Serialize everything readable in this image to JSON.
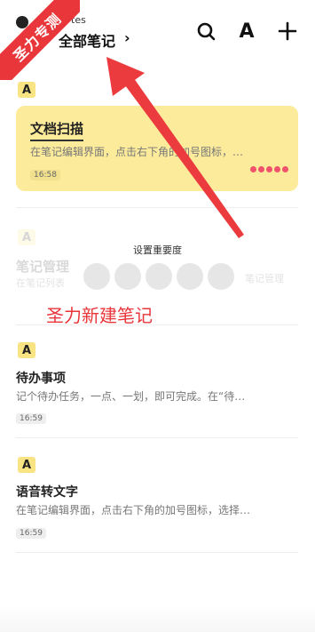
{
  "app": {
    "subtitle": "tes"
  },
  "header": {
    "folder_title": "全部笔记",
    "folder_chevron": "›",
    "search_icon": "search-icon",
    "font_icon": "A",
    "add_icon": "+"
  },
  "ribbon": {
    "text": "圣力专测"
  },
  "notes": [
    {
      "badge": "A",
      "title": "文档扫描",
      "summary": "在笔记编辑界面，点击右下角的加号图标，…",
      "time": "16:58",
      "highlighted": true,
      "importance_dots": 5
    },
    {
      "badge": "A",
      "title": "笔记管理",
      "summary": "在笔记列表",
      "time": "",
      "faded": true,
      "right_text": "笔记管理"
    },
    {
      "badge": "A",
      "title": "待办事项",
      "summary": "记个待办任务，一点、一划，即可完成。在“待…",
      "time": "16:59"
    },
    {
      "badge": "A",
      "title": "语音转文字",
      "summary": "在笔记编辑界面，点击右下角的加号图标，选择…",
      "time": "16:59"
    }
  ],
  "importance_popup": {
    "label": "设置重要度"
  },
  "annotation": {
    "text": "圣力新建笔记",
    "color": "#e8363a"
  },
  "colors": {
    "accent_red": "#e8363a",
    "card_yellow": "#fbeb9b",
    "badge_yellow": "#f9e483",
    "dot_pink": "#f0516b"
  }
}
